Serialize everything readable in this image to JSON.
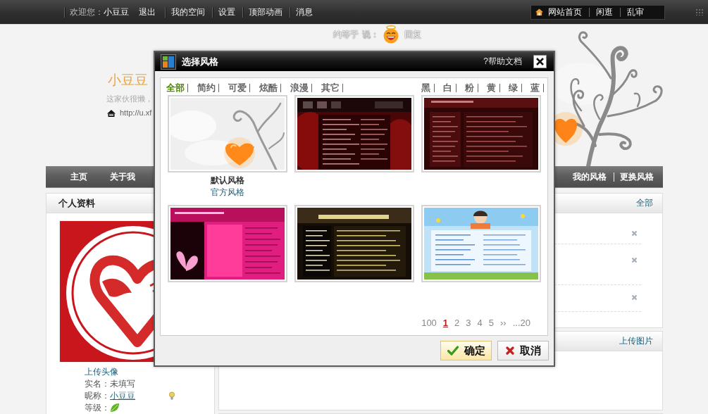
{
  "top_bar": {
    "welcome": "欢迎您：",
    "username": "小豆豆",
    "logout": "退出",
    "links": [
      "我的空间",
      "设置",
      "顶部动画",
      "消息"
    ],
    "site_links": [
      {
        "label": "网站首页",
        "kind": "home"
      },
      {
        "label": "闲逛",
        "kind": "plain"
      },
      {
        "label": "乱审",
        "kind": "plain"
      }
    ]
  },
  "header": {
    "marquee": {
      "author": "约等于",
      "says": "说：",
      "reply": "回复"
    },
    "name": "小豆豆",
    "bio": "这家伙很懒，",
    "url": "http://u.xf"
  },
  "nav": {
    "items": [
      "主页",
      "关于我"
    ],
    "style_links": [
      "我的风格",
      "更换风格"
    ]
  },
  "profile": {
    "title": "个人资料",
    "upload": "上传头像",
    "fields": [
      {
        "kind": "text",
        "label": "实名：",
        "value": "未填写"
      },
      {
        "kind": "nickname",
        "label": "昵称：",
        "value": "小豆豆"
      },
      {
        "kind": "level",
        "label": "等级："
      }
    ]
  },
  "panels": [
    {
      "action": "全部",
      "rows": [
        {
          "deletable": true
        },
        {
          "deletable": true
        },
        {
          "deletable": true
        }
      ]
    },
    {
      "action": "上传图片"
    }
  ],
  "dialog": {
    "title": "选择风格",
    "help": "?帮助文档",
    "categories": [
      {
        "label": "全部",
        "selected": true
      },
      {
        "label": "简约",
        "selected": false
      },
      {
        "label": "可爱",
        "selected": false
      },
      {
        "label": "炫酷",
        "selected": false
      },
      {
        "label": "浪漫",
        "selected": false
      },
      {
        "label": "其它",
        "selected": false
      }
    ],
    "colors": [
      {
        "label": "黑",
        "selected": false
      },
      {
        "label": "白",
        "selected": false
      },
      {
        "label": "粉",
        "selected": false
      },
      {
        "label": "黄",
        "selected": false
      },
      {
        "label": "绿",
        "selected": false
      },
      {
        "label": "蓝",
        "selected": false
      }
    ],
    "themes": [
      {
        "kind": "tree",
        "name": "默认风格",
        "source": "官方风格"
      },
      {
        "kind": "crimson"
      },
      {
        "kind": "maroon"
      },
      {
        "kind": "pink"
      },
      {
        "kind": "night"
      },
      {
        "kind": "sky"
      }
    ],
    "pagination": {
      "total": "100",
      "pages": [
        {
          "label": "1",
          "selected": true
        },
        {
          "label": "2",
          "selected": false
        },
        {
          "label": "3",
          "selected": false
        },
        {
          "label": "4",
          "selected": false
        },
        {
          "label": "5",
          "selected": false
        }
      ],
      "next": "››",
      "last": "...20"
    },
    "buttons": [
      {
        "kind": "confirm",
        "label": "确定"
      },
      {
        "kind": "cancel",
        "label": "取消"
      }
    ]
  }
}
